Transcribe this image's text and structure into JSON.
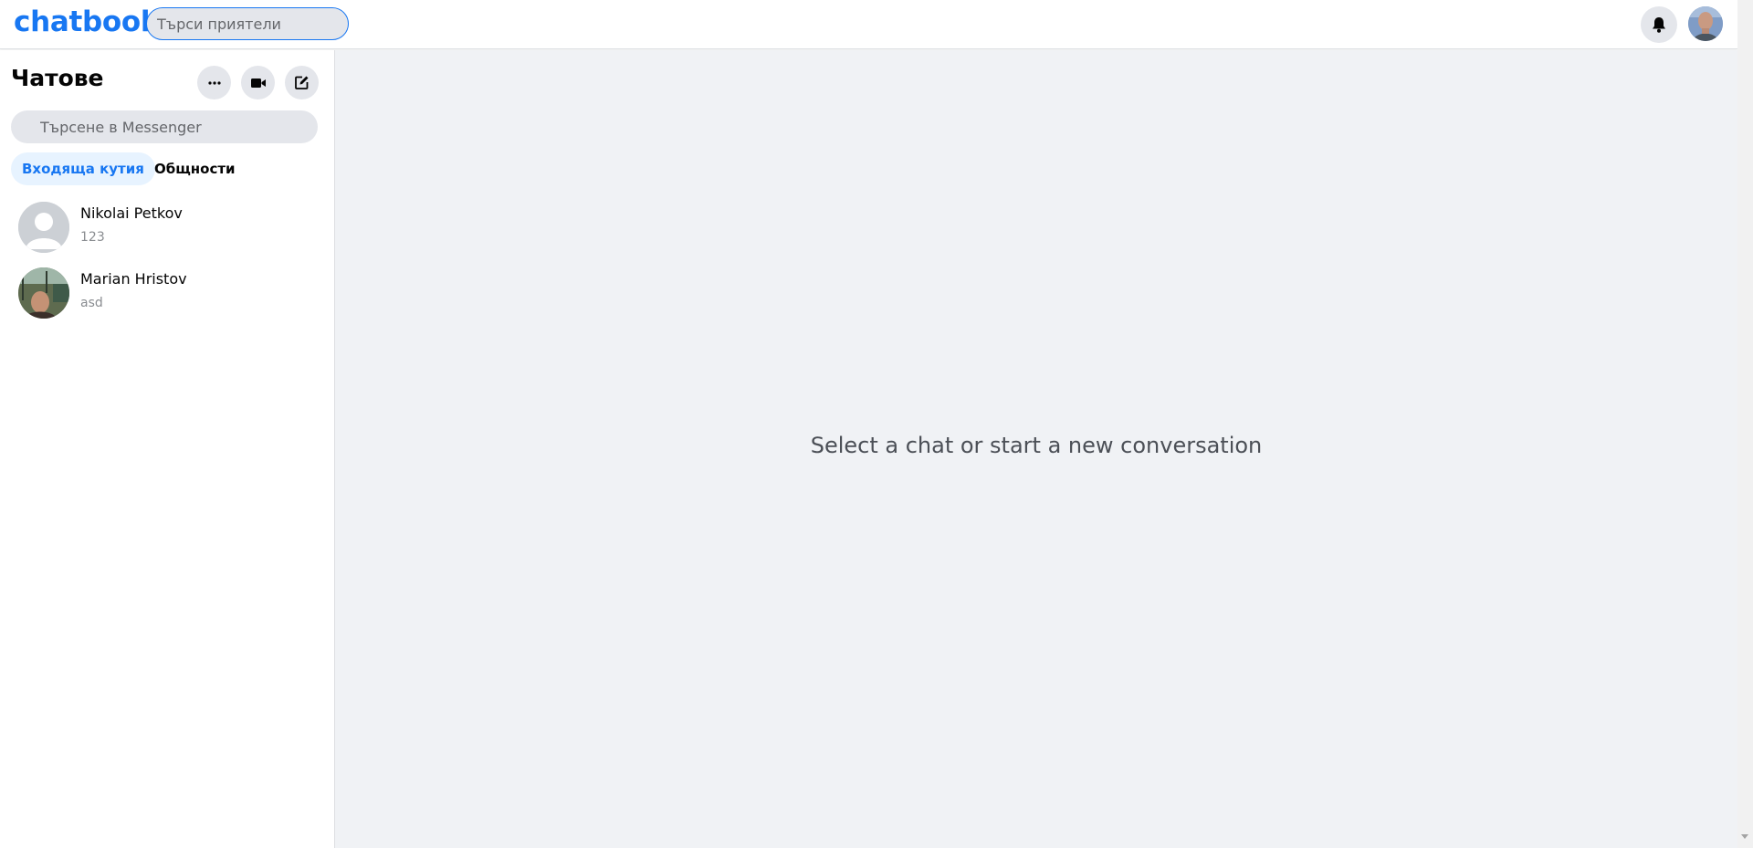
{
  "app": {
    "logo": "chatbook"
  },
  "header": {
    "search_placeholder": "Търси приятели",
    "bell_icon": "bell-icon",
    "profile_avatar": "user-avatar"
  },
  "sidebar": {
    "title": "Чатове",
    "actions": [
      {
        "icon": "more-horizontal-icon"
      },
      {
        "icon": "video-camera-icon"
      },
      {
        "icon": "compose-icon"
      }
    ],
    "search_placeholder": "Търсене в Messenger",
    "tabs": [
      {
        "label": "Входяща кутия",
        "active": true
      },
      {
        "label": "Общности",
        "active": false
      }
    ],
    "chats": [
      {
        "name": "Nikolai Petkov",
        "preview": "123",
        "avatar": "default-person"
      },
      {
        "name": "Marian Hristov",
        "preview": "asd",
        "avatar": "photo"
      }
    ]
  },
  "main": {
    "empty_message": "Select a chat or start a new conversation"
  },
  "colors": {
    "accent": "#1877f2",
    "main_background": "#f0f2f5",
    "button_background": "#e4e6eb",
    "active_tab_background": "#e7f3ff"
  }
}
